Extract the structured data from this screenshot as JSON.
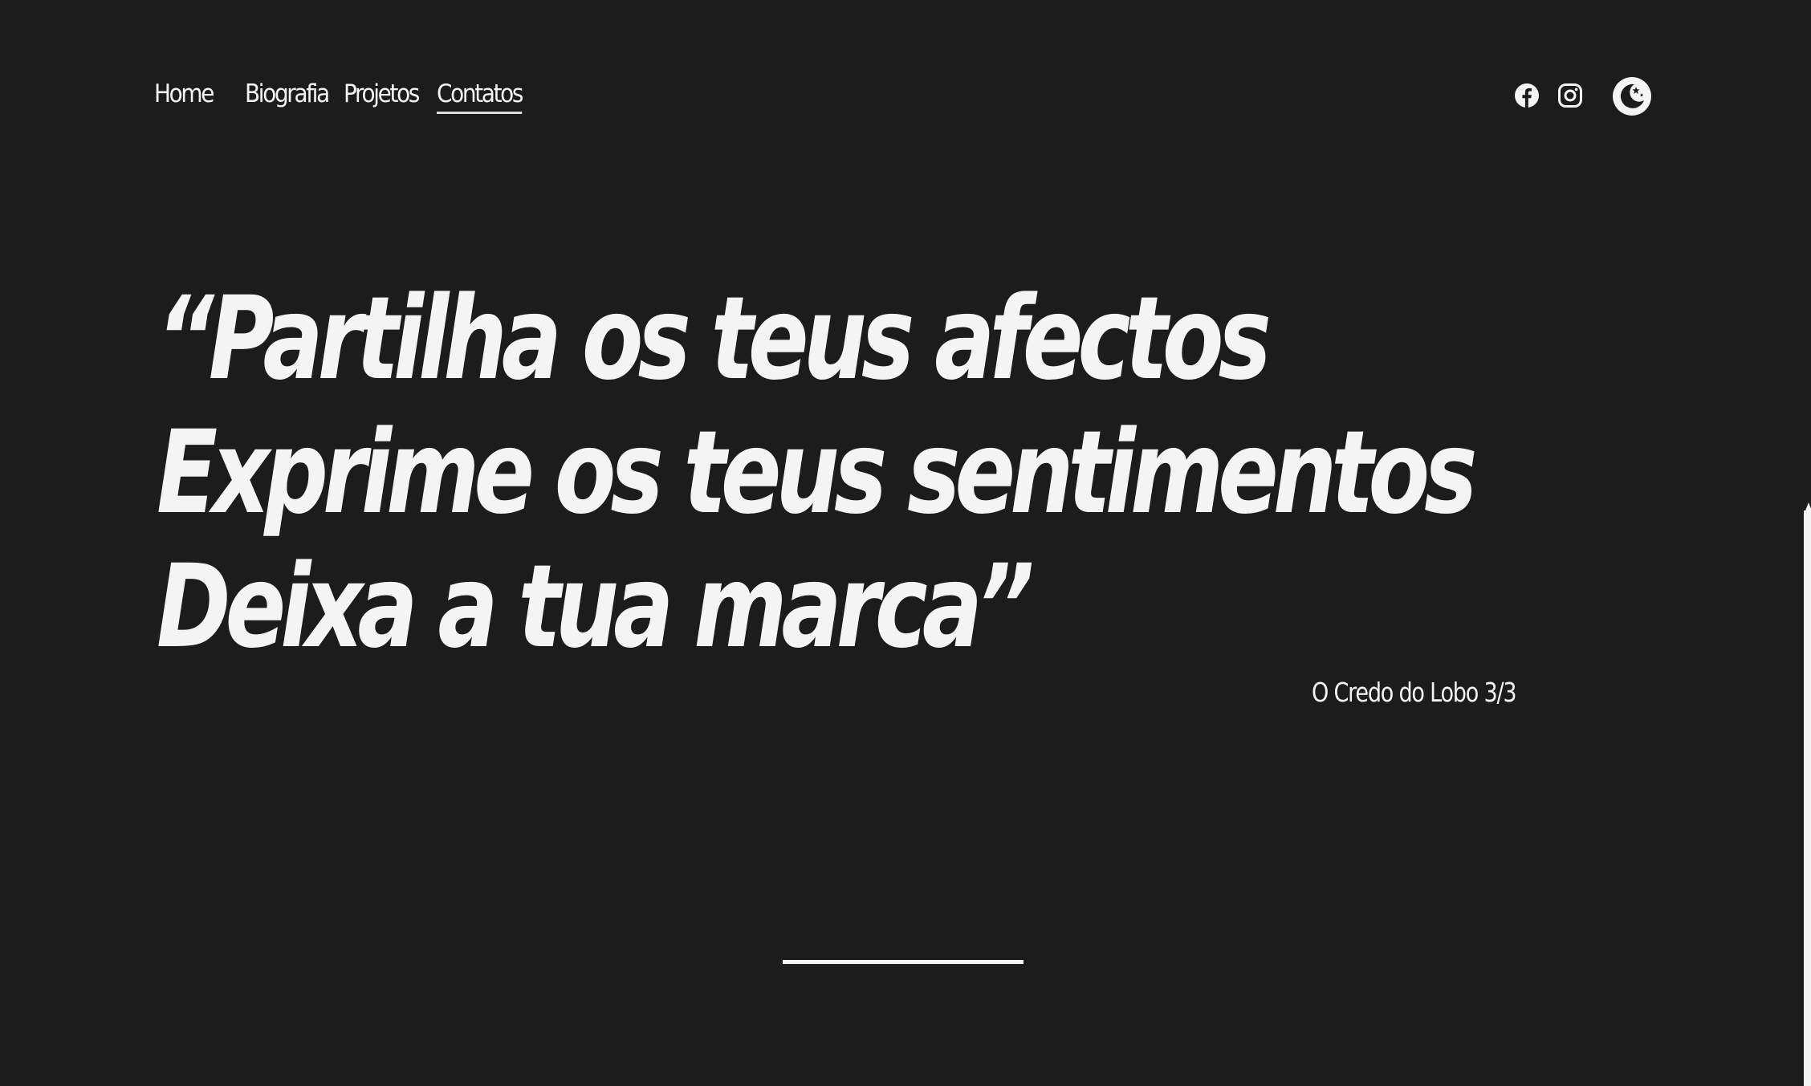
{
  "nav": {
    "items": [
      {
        "label": "Home",
        "active": false
      },
      {
        "label": "Biografia",
        "active": false
      },
      {
        "label": "Projetos",
        "active": false
      },
      {
        "label": "Contatos",
        "active": true
      }
    ]
  },
  "social": {
    "facebook_icon": "facebook-icon",
    "instagram_icon": "instagram-icon",
    "theme_icon": "moon-stars-icon"
  },
  "hero": {
    "lines": [
      "“Partilha os teus afectos",
      "Exprime os teus sentimentos",
      "Deixa a tua marca”"
    ],
    "caption": "O Credo do Lobo 3/3"
  },
  "colors": {
    "background": "#1c1c1c",
    "text": "#f4f4f4"
  }
}
